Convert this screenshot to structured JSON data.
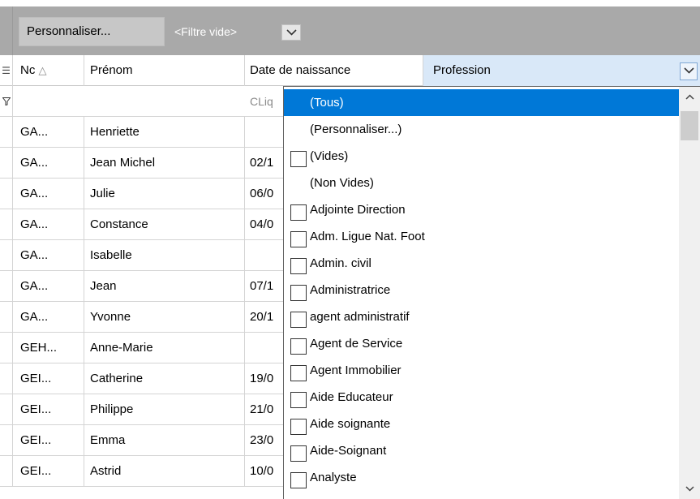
{
  "toolbar": {
    "personnaliser_label": "Personnaliser...",
    "filter_text": "<Filtre vide>",
    "filter_dropdown_icon": "chevron-down-icon"
  },
  "grid": {
    "columns": {
      "indicator_icon": "column-chooser-icon",
      "nom": "Nc",
      "nom_sort_icon": "sort-ascending-icon",
      "prenom": "Prénom",
      "date": "Date de naissance",
      "profession": "Profession"
    },
    "filter_row": {
      "indicator_icon": "filter-icon",
      "date_placeholder": "CLiq"
    },
    "rows": [
      {
        "nom": "GA...",
        "prenom": "Henriette",
        "date": ""
      },
      {
        "nom": "GA...",
        "prenom": "Jean Michel",
        "date": "02/1"
      },
      {
        "nom": "GA...",
        "prenom": "Julie",
        "date": "06/0"
      },
      {
        "nom": "GA...",
        "prenom": "Constance",
        "date": "04/0"
      },
      {
        "nom": "GA...",
        "prenom": "Isabelle",
        "date": ""
      },
      {
        "nom": "GA...",
        "prenom": "Jean",
        "date": "07/1"
      },
      {
        "nom": "GA...",
        "prenom": "Yvonne",
        "date": "20/1"
      },
      {
        "nom": "GEH...",
        "prenom": "Anne-Marie",
        "date": ""
      },
      {
        "nom": "GEI...",
        "prenom": "Catherine",
        "date": "19/0"
      },
      {
        "nom": "GEI...",
        "prenom": "Philippe",
        "date": "21/0"
      },
      {
        "nom": "GEI...",
        "prenom": "Emma",
        "date": "23/0"
      },
      {
        "nom": "GEI...",
        "prenom": "Astrid",
        "date": "10/0"
      }
    ]
  },
  "profession_filter": {
    "items": [
      {
        "label": "(Tous)",
        "checkbox": false,
        "highlighted": true
      },
      {
        "label": "(Personnaliser...)",
        "checkbox": false
      },
      {
        "label": "(Vides)",
        "checkbox": true
      },
      {
        "label": "(Non Vides)",
        "checkbox": false
      },
      {
        "label": "Adjointe  Direction",
        "checkbox": true
      },
      {
        "label": "Adm. Ligue Nat. Foot",
        "checkbox": true
      },
      {
        "label": "Admin. civil",
        "checkbox": true
      },
      {
        "label": "Administratrice",
        "checkbox": true
      },
      {
        "label": "agent administratif",
        "checkbox": true
      },
      {
        "label": "Agent de Service",
        "checkbox": true
      },
      {
        "label": "Agent Immobilier",
        "checkbox": true
      },
      {
        "label": "Aide Educateur",
        "checkbox": true
      },
      {
        "label": "Aide soignante",
        "checkbox": true
      },
      {
        "label": "Aide-Soignant",
        "checkbox": true
      },
      {
        "label": "Analyste",
        "checkbox": true
      }
    ]
  },
  "colors": {
    "toolbar_bg": "#a9a9a9",
    "selected_header_bg": "#d9e8f8",
    "highlight": "#0078d7"
  }
}
